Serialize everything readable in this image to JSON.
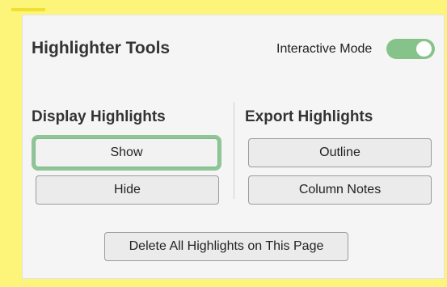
{
  "panel": {
    "title": "Highlighter Tools",
    "interactive_mode": {
      "label": "Interactive Mode",
      "enabled": true
    }
  },
  "display": {
    "heading": "Display Highlights",
    "show_label": "Show",
    "hide_label": "Hide"
  },
  "export": {
    "heading": "Export Highlights",
    "outline_label": "Outline",
    "column_notes_label": "Column Notes"
  },
  "delete_label": "Delete All Highlights on This Page",
  "colors": {
    "frame": "#fdf57a",
    "toggle_on": "#86c38a",
    "focus_ring": "#8fc597"
  }
}
